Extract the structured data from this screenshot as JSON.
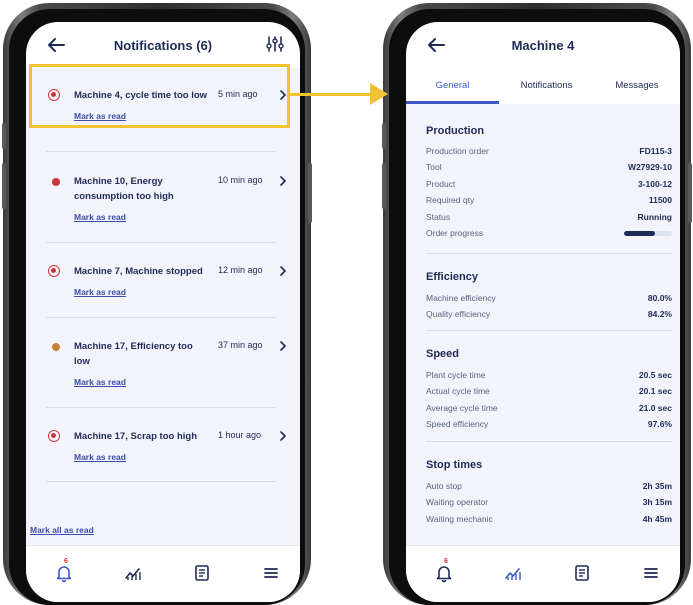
{
  "left_screen": {
    "header": {
      "title": "Notifications (6)"
    },
    "notifications": [
      {
        "title": "Machine 4, cycle time too low",
        "time": "5 min ago",
        "action": "Mark as read",
        "status": "alarm"
      },
      {
        "title": "Machine 10, Energy consumption too high",
        "time": "10 min ago",
        "action": "Mark as read",
        "status": "error"
      },
      {
        "title": "Machine 7, Machine stopped",
        "time": "12 min ago",
        "action": "Mark as read",
        "status": "alarm"
      },
      {
        "title": "Machine 17, Efficiency too low",
        "time": "37 min ago",
        "action": "Mark as read",
        "status": "warning"
      },
      {
        "title": "Machine 17, Scrap too high",
        "time": "1 hour ago",
        "action": "Mark as read",
        "status": "alarm"
      }
    ],
    "mark_all": "Mark all as read",
    "nav": {
      "bell_badge": "6"
    }
  },
  "right_screen": {
    "header": {
      "title": "Machine 4"
    },
    "tabs": [
      "General",
      "Notifications",
      "Messages"
    ],
    "active_tab": "General",
    "sections": {
      "production": {
        "title": "Production",
        "rows": [
          {
            "label": "Production order",
            "value": "FD115-3"
          },
          {
            "label": "Tool",
            "value": "W27929-10"
          },
          {
            "label": "Product",
            "value": "3-100-12"
          },
          {
            "label": "Required qty",
            "value": "11500"
          },
          {
            "label": "Status",
            "value": "Running"
          },
          {
            "label": "Order progress",
            "progress": 0.65
          }
        ]
      },
      "efficiency": {
        "title": "Efficiency",
        "rows": [
          {
            "label": "Machine efficiency",
            "value": "80.0%"
          },
          {
            "label": "Quality efficiency",
            "value": "84.2%"
          }
        ]
      },
      "speed": {
        "title": "Speed",
        "rows": [
          {
            "label": "Plant cycle time",
            "value": "20.5 sec"
          },
          {
            "label": "Actual cycle time",
            "value": "20.1 sec"
          },
          {
            "label": "Average cycle time",
            "value": "21.0 sec"
          },
          {
            "label": "Speed efficiency",
            "value": "97.6%"
          }
        ]
      },
      "stop_times": {
        "title": "Stop times",
        "rows": [
          {
            "label": "Auto stop",
            "value": "2h 35m"
          },
          {
            "label": "Waiting operator",
            "value": "3h 15m"
          },
          {
            "label": "Waiting mechanic",
            "value": "4h 45m"
          }
        ]
      }
    },
    "nav": {
      "bell_badge": "6"
    }
  },
  "colors": {
    "navy": "#1f2a56",
    "accent_blue": "#3f57c4",
    "highlight_yellow": "#f2c230",
    "alarm_red": "#c8353b",
    "warning_orange": "#c97f3a"
  }
}
